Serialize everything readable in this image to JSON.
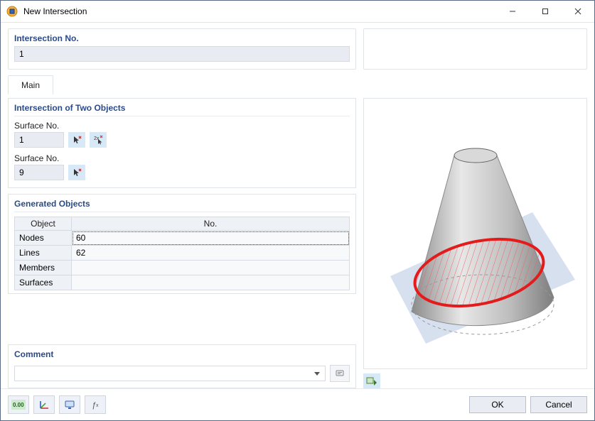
{
  "window": {
    "title": "New Intersection"
  },
  "intersection_no": {
    "label": "Intersection No.",
    "value": "1"
  },
  "tabs": {
    "main": "Main"
  },
  "section_two_objects": {
    "header": "Intersection of Two Objects",
    "surface1_label": "Surface No.",
    "surface1_value": "1",
    "surface2_label": "Surface No.",
    "surface2_value": "9"
  },
  "generated": {
    "header": "Generated Objects",
    "col_object": "Object",
    "col_no": "No.",
    "rows": [
      {
        "object": "Nodes",
        "no": "60"
      },
      {
        "object": "Lines",
        "no": "62"
      },
      {
        "object": "Members",
        "no": ""
      },
      {
        "object": "Surfaces",
        "no": ""
      }
    ]
  },
  "comment": {
    "header": "Comment",
    "value": ""
  },
  "buttons": {
    "ok": "OK",
    "cancel": "Cancel"
  }
}
